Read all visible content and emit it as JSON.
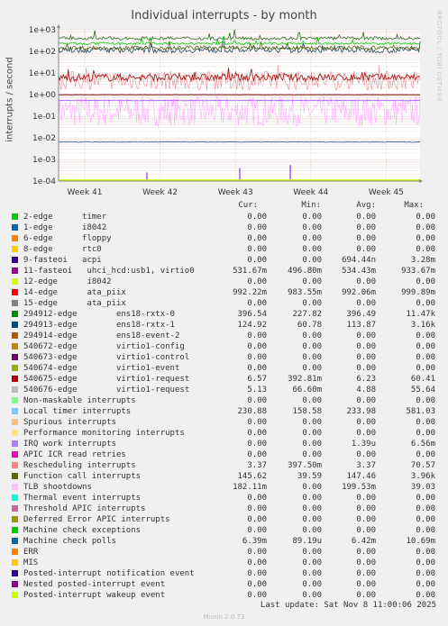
{
  "title": "Individual interrupts - by month",
  "side_label": "RRDTOOL / TOBI OETIKER",
  "footer": {
    "last_update": "Last update: Sat Nov  8 11:00:06 2025",
    "version": "Munin 2.0.73"
  },
  "chart_data": {
    "type": "line",
    "title": "Individual interrupts - by month",
    "ylabel": "interrupts / second",
    "yscale": "log",
    "yticks": [
      "1e+03",
      "1e+02",
      "1e+01",
      "1e+00",
      "1e-01",
      "1e-02",
      "1e-03",
      "1e-04"
    ],
    "ylim": [
      0.0001,
      1000
    ],
    "xticks": [
      "Week 41",
      "Week 42",
      "Week 43",
      "Week 44",
      "Week 45"
    ],
    "grid": true,
    "series": [
      {
        "name": "Posted-interrupt wakeup event",
        "color": "#ccff00",
        "approx_level": 0
      },
      {
        "name": "Local timer interrupts",
        "color": "#00cc00",
        "approx_level": 230
      },
      {
        "name": "294912-edge ens18-rxtx-0",
        "color": "#2a6a1a",
        "approx_level": 400
      },
      {
        "name": "Function call interrupts",
        "color": "#5a5a10",
        "approx_level": 147
      },
      {
        "name": "294913-edge ens18-rxtx-1",
        "color": "#1a4a5a",
        "approx_level": 114
      },
      {
        "name": "Rescheduling interrupts",
        "color": "#ea8f8f",
        "approx_level": 4.5
      },
      {
        "name": "540675-edge virtio1-request",
        "color": "#a01010",
        "approx_level": 6.2
      },
      {
        "name": "14-edge ata_piix",
        "color": "#7a0a0a",
        "approx_level": 0.99
      },
      {
        "name": "TLB shootdowns",
        "color": "#ffaaff",
        "approx_level": 0.2
      },
      {
        "name": "Machine check polls",
        "color": "#2a5aa0",
        "approx_level": 0.0064
      },
      {
        "name": "11-fasteoi uhci_hcd:usb1, virtio0",
        "color": "#8a2aff",
        "approx_level": 0.53
      }
    ]
  },
  "legend": {
    "columns": [
      "Cur:",
      "Min:",
      "Avg:",
      "Max:"
    ],
    "rows": [
      {
        "color": "#00cc00",
        "name": "2-edge      timer",
        "cur": "0.00",
        "min": "0.00",
        "avg": "0.00",
        "max": "0.00"
      },
      {
        "color": "#0066b3",
        "name": "1-edge      i8042",
        "cur": "0.00",
        "min": "0.00",
        "avg": "0.00",
        "max": "0.00"
      },
      {
        "color": "#ff8000",
        "name": "6-edge      floppy",
        "cur": "0.00",
        "min": "0.00",
        "avg": "0.00",
        "max": "0.00"
      },
      {
        "color": "#ffcc00",
        "name": "8-edge      rtc0",
        "cur": "0.00",
        "min": "0.00",
        "avg": "0.00",
        "max": "0.00"
      },
      {
        "color": "#330099",
        "name": "9-fasteoi   acpi",
        "cur": "0.00",
        "min": "0.00",
        "avg": "694.44n",
        "max": "3.28m"
      },
      {
        "color": "#990099",
        "name": "11-fasteoi   uhci_hcd:usb1, virtio0",
        "cur": "531.67m",
        "min": "496.80m",
        "avg": "534.43m",
        "max": "933.67m"
      },
      {
        "color": "#ccff00",
        "name": "12-edge      i8042",
        "cur": "0.00",
        "min": "0.00",
        "avg": "0.00",
        "max": "0.00"
      },
      {
        "color": "#ff0000",
        "name": "14-edge      ata_piix",
        "cur": "992.22m",
        "min": "983.55m",
        "avg": "992.06m",
        "max": "999.89m"
      },
      {
        "color": "#808080",
        "name": "15-edge      ata_piix",
        "cur": "0.00",
        "min": "0.00",
        "avg": "0.00",
        "max": "0.00"
      },
      {
        "color": "#008f00",
        "name": "294912-edge        ens18-rxtx-0",
        "cur": "396.54",
        "min": "227.82",
        "avg": "396.49",
        "max": "11.47k"
      },
      {
        "color": "#00487d",
        "name": "294913-edge        ens18-rxtx-1",
        "cur": "124.92",
        "min": "60.78",
        "avg": "113.87",
        "max": "3.16k"
      },
      {
        "color": "#b35a00",
        "name": "294914-edge        ens18-event-2",
        "cur": "0.00",
        "min": "0.00",
        "avg": "0.00",
        "max": "0.00"
      },
      {
        "color": "#b38f00",
        "name": "540672-edge        virtio1-config",
        "cur": "0.00",
        "min": "0.00",
        "avg": "0.00",
        "max": "0.00"
      },
      {
        "color": "#6b006b",
        "name": "540673-edge        virtio1-control",
        "cur": "0.00",
        "min": "0.00",
        "avg": "0.00",
        "max": "0.00"
      },
      {
        "color": "#8fb300",
        "name": "540674-edge        virtio1-event",
        "cur": "0.00",
        "min": "0.00",
        "avg": "0.00",
        "max": "0.00"
      },
      {
        "color": "#b30000",
        "name": "540675-edge        virtio1-request",
        "cur": "6.57",
        "min": "392.81m",
        "avg": "6.23",
        "max": "60.41"
      },
      {
        "color": "#bebebe",
        "name": "540676-edge        virtio1-request",
        "cur": "5.13",
        "min": "66.60m",
        "avg": "4.88",
        "max": "55.64"
      },
      {
        "color": "#80ff80",
        "name": "Non-maskable interrupts",
        "cur": "0.00",
        "min": "0.00",
        "avg": "0.00",
        "max": "0.00"
      },
      {
        "color": "#80c9ff",
        "name": "Local timer interrupts",
        "cur": "230.88",
        "min": "158.58",
        "avg": "233.98",
        "max": "581.03"
      },
      {
        "color": "#ffc080",
        "name": "Spurious interrupts",
        "cur": "0.00",
        "min": "0.00",
        "avg": "0.00",
        "max": "0.00"
      },
      {
        "color": "#ffe680",
        "name": "Performance monitoring interrupts",
        "cur": "0.00",
        "min": "0.00",
        "avg": "0.00",
        "max": "0.00"
      },
      {
        "color": "#aa80ff",
        "name": "IRQ work interrupts",
        "cur": "0.00",
        "min": "0.00",
        "avg": "1.39u",
        "max": "6.56m"
      },
      {
        "color": "#ee00cc",
        "name": "APIC ICR read retries",
        "cur": "0.00",
        "min": "0.00",
        "avg": "0.00",
        "max": "0.00"
      },
      {
        "color": "#ff8080",
        "name": "Rescheduling interrupts",
        "cur": "3.37",
        "min": "397.50m",
        "avg": "3.37",
        "max": "70.57"
      },
      {
        "color": "#666600",
        "name": "Function call interrupts",
        "cur": "145.62",
        "min": "39.59",
        "avg": "147.46",
        "max": "3.96k"
      },
      {
        "color": "#ffbfff",
        "name": "TLB shootdowns",
        "cur": "182.11m",
        "min": "0.00",
        "avg": "199.53m",
        "max": "39.03"
      },
      {
        "color": "#00ffcc",
        "name": "Thermal event interrupts",
        "cur": "0.00",
        "min": "0.00",
        "avg": "0.00",
        "max": "0.00"
      },
      {
        "color": "#cc6699",
        "name": "Threshold APIC interrupts",
        "cur": "0.00",
        "min": "0.00",
        "avg": "0.00",
        "max": "0.00"
      },
      {
        "color": "#999900",
        "name": "Deferred Error APIC interrupts",
        "cur": "0.00",
        "min": "0.00",
        "avg": "0.00",
        "max": "0.00"
      },
      {
        "color": "#00cc00",
        "name": "Machine check exceptions",
        "cur": "0.00",
        "min": "0.00",
        "avg": "0.00",
        "max": "0.00"
      },
      {
        "color": "#0066b3",
        "name": "Machine check polls",
        "cur": "6.39m",
        "min": "89.19u",
        "avg": "6.42m",
        "max": "10.69m"
      },
      {
        "color": "#ff8000",
        "name": "ERR",
        "cur": "0.00",
        "min": "0.00",
        "avg": "0.00",
        "max": "0.00"
      },
      {
        "color": "#ffcc00",
        "name": "MIS",
        "cur": "0.00",
        "min": "0.00",
        "avg": "0.00",
        "max": "0.00"
      },
      {
        "color": "#330099",
        "name": "Posted-interrupt notification event",
        "cur": "0.00",
        "min": "0.00",
        "avg": "0.00",
        "max": "0.00"
      },
      {
        "color": "#990099",
        "name": "Nested posted-interrupt event",
        "cur": "0.00",
        "min": "0.00",
        "avg": "0.00",
        "max": "0.00"
      },
      {
        "color": "#ccff00",
        "name": "Posted-interrupt wakeup event",
        "cur": "0.00",
        "min": "0.00",
        "avg": "0.00",
        "max": "0.00"
      }
    ]
  }
}
